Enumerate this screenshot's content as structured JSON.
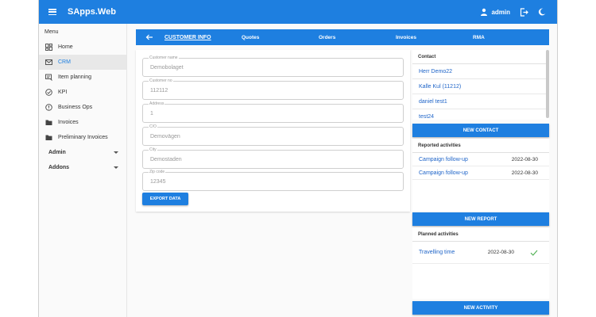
{
  "app": {
    "title": "SApps.Web",
    "user": "admin"
  },
  "sidebar": {
    "menu_title": "Menu",
    "items": [
      {
        "label": "Home",
        "icon": "dashboard-icon"
      },
      {
        "label": "CRM",
        "icon": "mail-icon",
        "active": true
      },
      {
        "label": "Item planning",
        "icon": "itemplan-icon"
      },
      {
        "label": "KPI",
        "icon": "check-circle-icon"
      },
      {
        "label": "Business Ops",
        "icon": "alert-circle-icon"
      },
      {
        "label": "Invoices",
        "icon": "folder-icon"
      },
      {
        "label": "Preliminary Invoices",
        "icon": "folder-icon"
      }
    ],
    "groups": [
      "Admin",
      "Addons"
    ]
  },
  "tabs": [
    "CUSTOMER INFO",
    "Quotes",
    "Orders",
    "Invoices",
    "RMA"
  ],
  "form": {
    "fields": [
      {
        "label": "Customer name",
        "value": "Demobolaget"
      },
      {
        "label": "Customer no",
        "value": "112112"
      },
      {
        "label": "Address",
        "value": "1"
      },
      {
        "label": "C/O",
        "value": "Demovägen"
      },
      {
        "label": "City",
        "value": "Demostaden"
      },
      {
        "label": "Zip code",
        "value": "12345"
      }
    ],
    "export_label": "EXPORT DATA"
  },
  "contacts": {
    "title": "Contact",
    "items": [
      "Herr Demo22",
      "Kalle Kul (11212)",
      "daniel test1",
      "test24"
    ],
    "new_label": "NEW CONTACT"
  },
  "reported": {
    "title": "Reported activities",
    "items": [
      {
        "name": "Campaign follow-up",
        "date": "2022-08-30"
      },
      {
        "name": "Campaign follow-up",
        "date": "2022-08-30"
      }
    ],
    "new_label": "NEW REPORT"
  },
  "planned": {
    "title": "Planned activities",
    "items": [
      {
        "name": "Travelling time",
        "date": "2022-08-30"
      }
    ],
    "new_label": "NEW ACTIVITY"
  },
  "colors": {
    "primary": "#1e7fe0",
    "link": "#1e64c8",
    "check": "#4caf50"
  }
}
